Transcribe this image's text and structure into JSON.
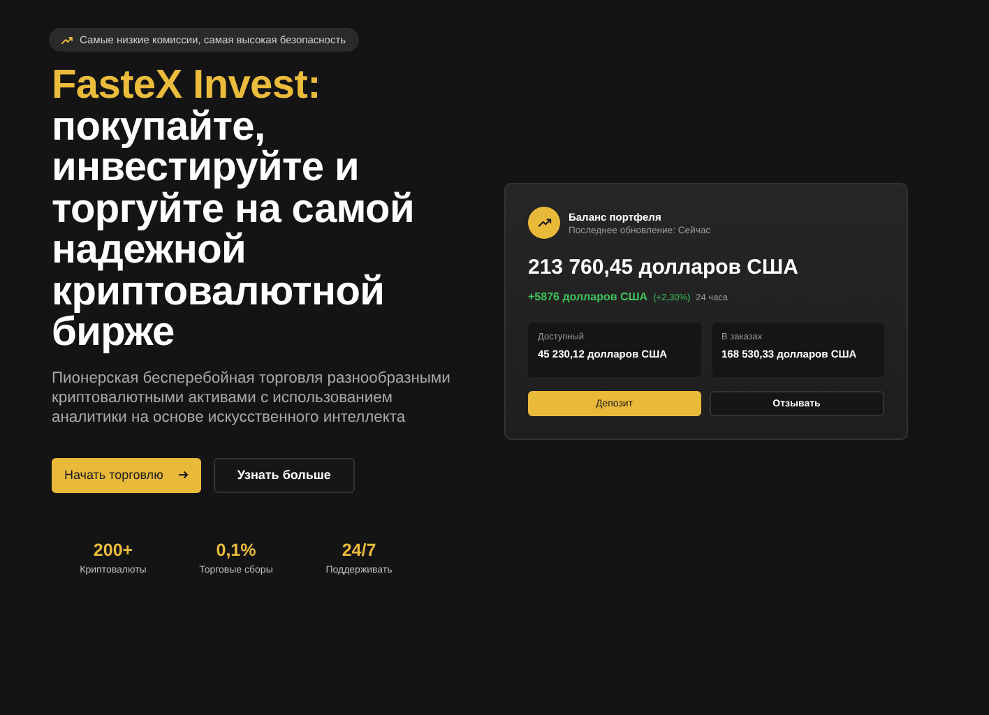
{
  "badge": {
    "text": "Самые низкие комиссии, самая высокая безопасность"
  },
  "headline": {
    "brand": "FasteX Invest:",
    "lines": [
      "покупайте,",
      "инвестируйте и",
      "торгуйте на самой",
      "надежной",
      "криптовалютной",
      "бирже"
    ]
  },
  "description": "Пионерская бесперебойная торговля разнообразными криптовалютными активами с использованием аналитики на основе искусственного интеллекта",
  "buttons": [
    {
      "label": "Начать торговлю",
      "kind": "primary"
    },
    {
      "label": "Узнать больше",
      "kind": "secondary"
    }
  ],
  "stats": [
    {
      "value": "200+",
      "label": "Криптовалюты"
    },
    {
      "value": "0,1%",
      "label": "Торговые сборы"
    },
    {
      "value": "24/7",
      "label": "Поддерживать"
    }
  ],
  "portfolio": {
    "title": "Баланс портфеля",
    "updated": "Последнее обновление: Сейчас",
    "balance": "213 760,45 долларов США",
    "change": "+5876 долларов США",
    "change_pct": "(+2,30%)",
    "period": "24 часа",
    "tiles": [
      {
        "label": "Доступный",
        "value": "45 230,12 долларов США"
      },
      {
        "label": "В заказах",
        "value": "168 530,33 долларов США"
      }
    ],
    "actions": [
      {
        "label": "Депозит",
        "kind": "primary"
      },
      {
        "label": "Отзывать",
        "kind": "secondary"
      }
    ]
  }
}
